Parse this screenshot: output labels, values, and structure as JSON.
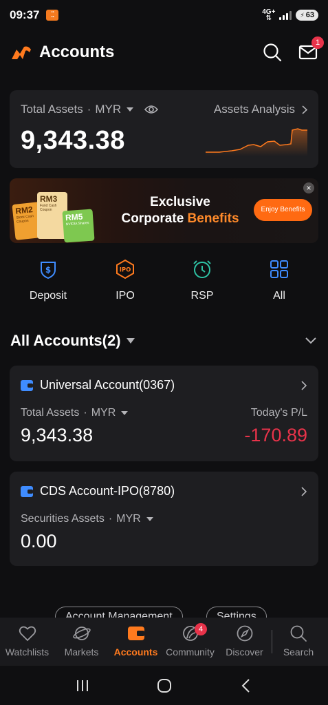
{
  "status": {
    "time": "09:37",
    "network": "4G+",
    "battery": "63"
  },
  "header": {
    "title": "Accounts",
    "notification_count": "1"
  },
  "summary": {
    "label": "Total Assets",
    "currency": "MYR",
    "value": "9,343.38",
    "analysis_label": "Assets Analysis"
  },
  "banner": {
    "line1": "Exclusive",
    "line2_prefix": "Corporate",
    "line2_accent": "Benefits",
    "button": "Enjoy Benefits",
    "coupons": [
      {
        "amount": "RM2",
        "text": "Stock Cash Coupon"
      },
      {
        "amount": "RM3",
        "text": "Fund Cash Coupon"
      },
      {
        "amount": "RM5",
        "text": "NVIDIA Shares"
      }
    ]
  },
  "shortcuts": [
    {
      "label": "Deposit",
      "icon": "deposit-icon"
    },
    {
      "label": "IPO",
      "icon": "ipo-icon"
    },
    {
      "label": "RSP",
      "icon": "rsp-clock-icon"
    },
    {
      "label": "All",
      "icon": "grid-icon"
    }
  ],
  "accounts_section": {
    "title": "All Accounts(2)"
  },
  "accounts": [
    {
      "name": "Universal Account(0367)",
      "left_label": "Total Assets",
      "currency": "MYR",
      "left_value": "9,343.38",
      "right_label": "Today's P/L",
      "right_value": "-170.89"
    },
    {
      "name": "CDS Account-IPO(8780)",
      "left_label": "Securities Assets",
      "currency": "MYR",
      "left_value": "0.00"
    }
  ],
  "pills": {
    "account_management": "Account Management",
    "settings": "Settings"
  },
  "nav": {
    "items": [
      {
        "label": "Watchlists",
        "icon": "heart-icon"
      },
      {
        "label": "Markets",
        "icon": "planet-icon"
      },
      {
        "label": "Accounts",
        "icon": "wallet-icon"
      },
      {
        "label": "Community",
        "icon": "community-icon"
      },
      {
        "label": "Discover",
        "icon": "compass-icon"
      },
      {
        "label": "Search",
        "icon": "search-icon"
      }
    ],
    "community_badge": "4",
    "active": "Accounts"
  },
  "colors": {
    "accent": "#ff7a1e",
    "negative": "#e8334a",
    "card": "#1e1e21",
    "background": "#0f0f11"
  }
}
